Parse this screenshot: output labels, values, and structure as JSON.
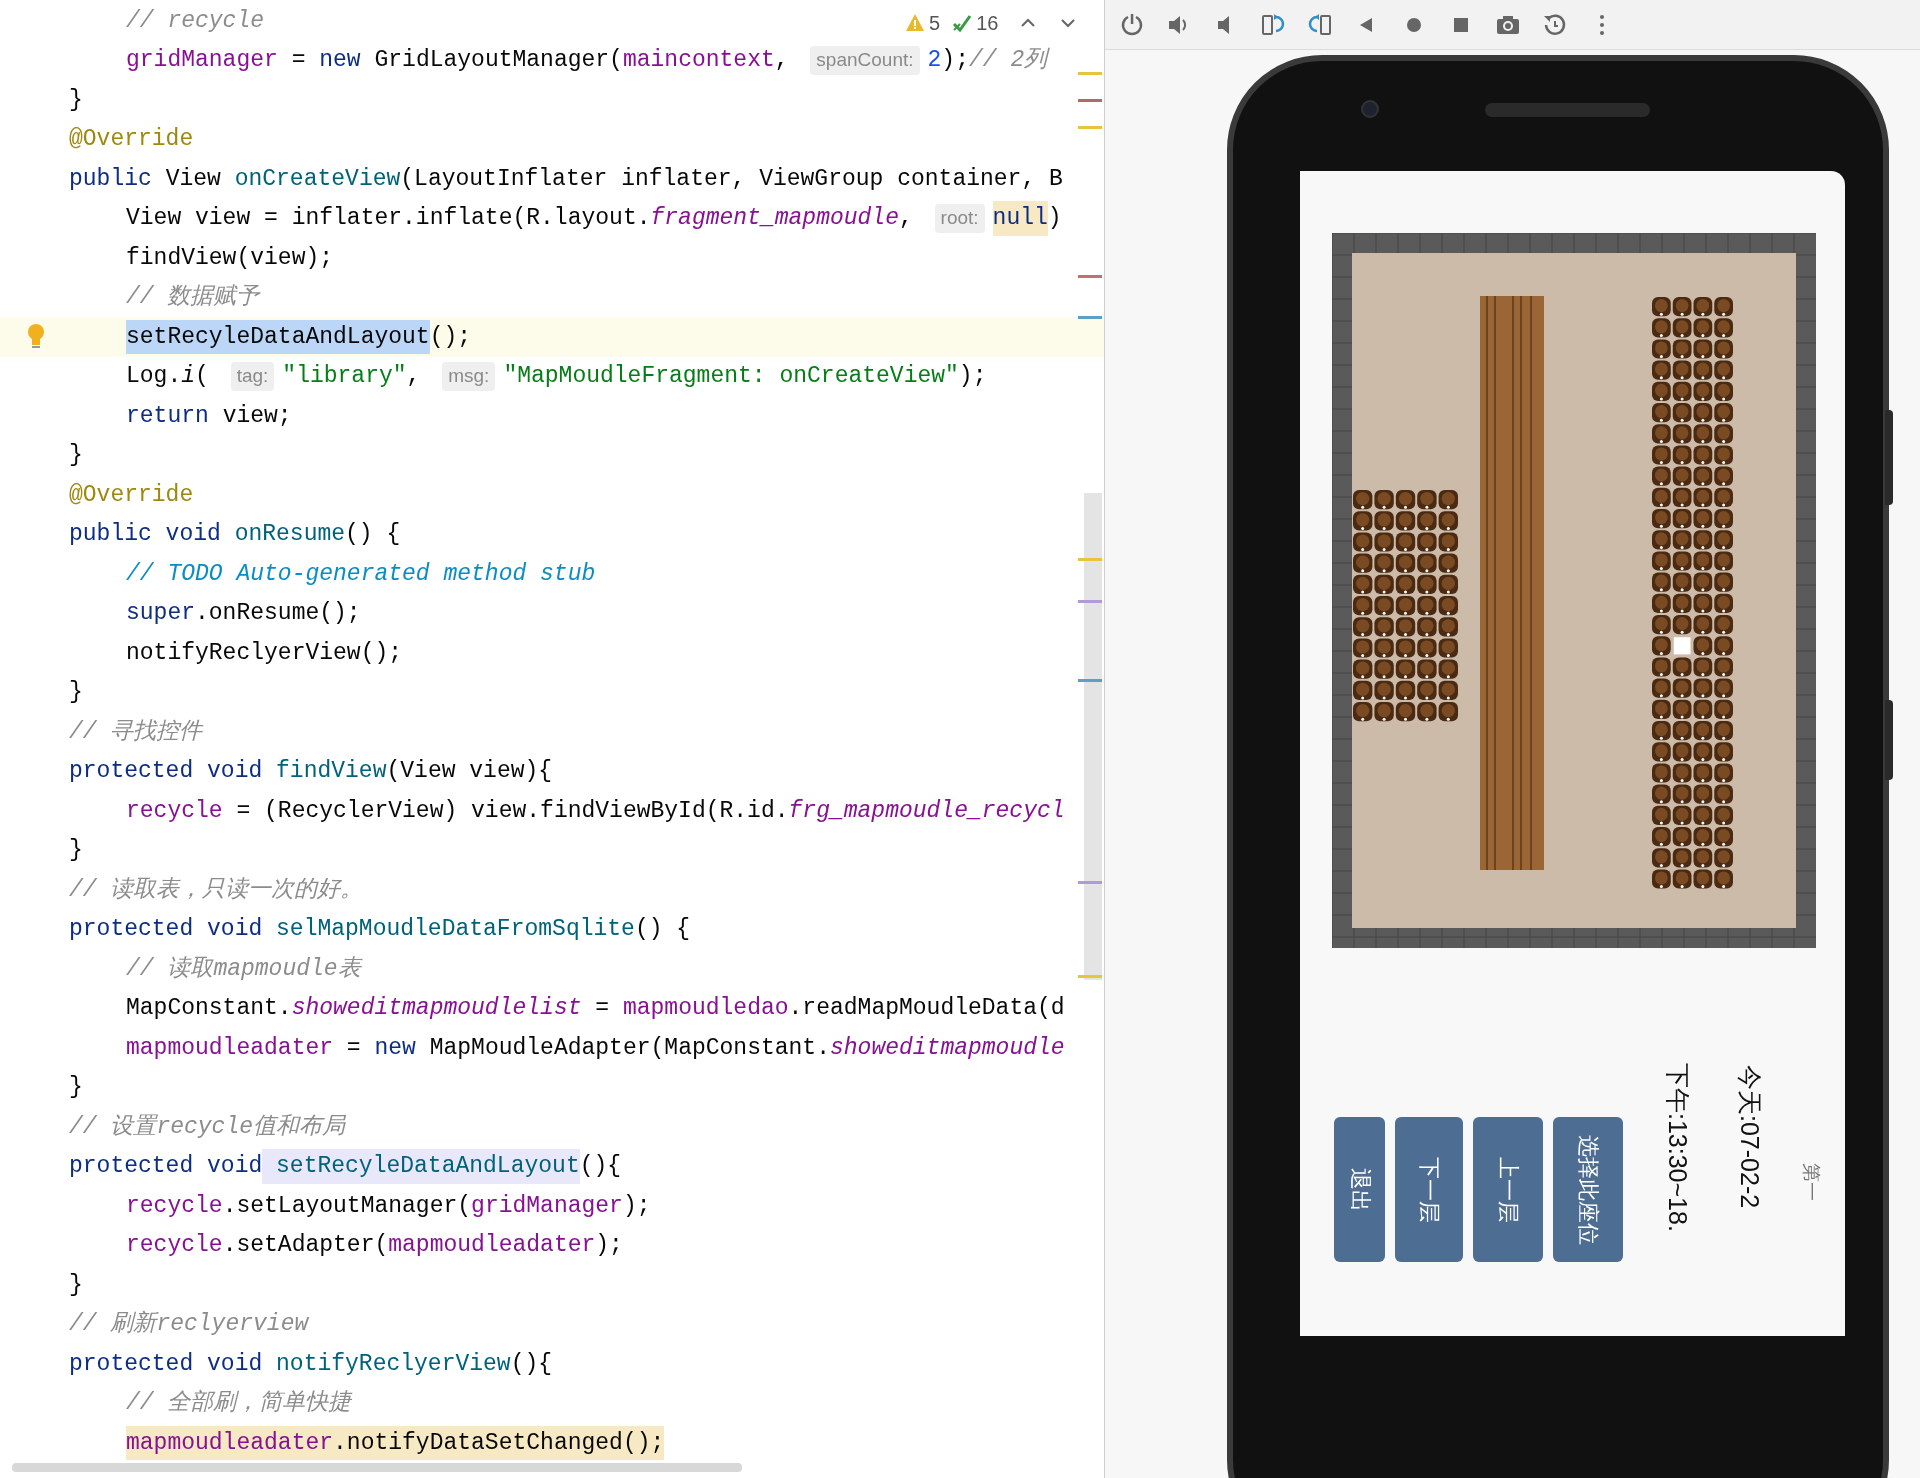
{
  "editor": {
    "inspections": [
      {
        "kind": "warning",
        "count": "5"
      },
      {
        "kind": "typo",
        "count": "16"
      }
    ],
    "lines": [
      {
        "indented": true,
        "current": false,
        "tokens": [
          {
            "kind": "comment",
            "text": "// recycle"
          }
        ]
      },
      {
        "indented": true,
        "current": false,
        "tokens": [
          {
            "kind": "field",
            "text": "gridManager"
          },
          {
            "kind": "plain",
            "text": " = "
          },
          {
            "kind": "kw",
            "text": "new"
          },
          {
            "kind": "plain",
            "text": " GridLayoutManager("
          },
          {
            "kind": "field",
            "text": "maincontext"
          },
          {
            "kind": "plain",
            "text": ", "
          },
          {
            "kind": "hint",
            "text": "spanCount:"
          },
          {
            "kind": "number",
            "text": "2"
          },
          {
            "kind": "plain",
            "text": ");"
          },
          {
            "kind": "comment",
            "text": "// 2列"
          }
        ]
      },
      {
        "indented": false,
        "current": false,
        "tokens": [
          {
            "kind": "plain",
            "text": "}"
          }
        ]
      },
      {
        "indented": false,
        "current": false,
        "tokens": [
          {
            "kind": "annotation",
            "text": "@Override"
          }
        ]
      },
      {
        "indented": false,
        "current": false,
        "tokens": [
          {
            "kind": "kw",
            "text": "public"
          },
          {
            "kind": "plain",
            "text": " View "
          },
          {
            "kind": "method",
            "text": "onCreateView"
          },
          {
            "kind": "plain",
            "text": "(LayoutInflater inflater, ViewGroup container, B"
          }
        ]
      },
      {
        "indented": true,
        "current": false,
        "tokens": [
          {
            "kind": "plain",
            "text": "View view = inflater.inflate(R.layout."
          },
          {
            "kind": "static",
            "text": "fragment_mapmoudle"
          },
          {
            "kind": "plain",
            "text": ", "
          },
          {
            "kind": "hint",
            "text": "root:"
          },
          {
            "kind": "kw_match",
            "text": "null"
          },
          {
            "kind": "plain",
            "text": ")"
          }
        ]
      },
      {
        "indented": true,
        "current": false,
        "tokens": [
          {
            "kind": "plain",
            "text": "findView(view);"
          }
        ]
      },
      {
        "indented": true,
        "current": false,
        "tokens": [
          {
            "kind": "comment",
            "text": "// 数据赋予"
          }
        ]
      },
      {
        "indented": true,
        "current": true,
        "tokens": [
          {
            "kind": "selection",
            "text": "setRecyleDataAndLayout"
          },
          {
            "kind": "plain",
            "text": "();"
          }
        ]
      },
      {
        "indented": true,
        "current": false,
        "tokens": [
          {
            "kind": "plain",
            "text": "Log."
          },
          {
            "kind": "static_call",
            "text": "i"
          },
          {
            "kind": "plain",
            "text": "( "
          },
          {
            "kind": "hint",
            "text": "tag:"
          },
          {
            "kind": "string",
            "text": "\"library\""
          },
          {
            "kind": "plain",
            "text": ", "
          },
          {
            "kind": "hint",
            "text": "msg:"
          },
          {
            "kind": "string",
            "text": "\"MapMoudleFragment: onCreateView\""
          },
          {
            "kind": "plain",
            "text": ");"
          }
        ]
      },
      {
        "indented": true,
        "current": false,
        "tokens": [
          {
            "kind": "kw",
            "text": "return"
          },
          {
            "kind": "plain",
            "text": " view;"
          }
        ]
      },
      {
        "indented": false,
        "current": false,
        "tokens": [
          {
            "kind": "plain",
            "text": "}"
          }
        ]
      },
      {
        "indented": false,
        "current": false,
        "tokens": [
          {
            "kind": "annotation",
            "text": "@Override"
          }
        ]
      },
      {
        "indented": false,
        "current": false,
        "tokens": [
          {
            "kind": "kw",
            "text": "public void"
          },
          {
            "kind": "method",
            "text": " onResume"
          },
          {
            "kind": "plain",
            "text": "() {"
          }
        ]
      },
      {
        "indented": true,
        "current": false,
        "tokens": [
          {
            "kind": "todo",
            "text": "// TODO Auto-generated method stub"
          }
        ]
      },
      {
        "indented": true,
        "current": false,
        "tokens": [
          {
            "kind": "kw",
            "text": "super"
          },
          {
            "kind": "plain",
            "text": ".onResume();"
          }
        ]
      },
      {
        "indented": true,
        "current": false,
        "tokens": [
          {
            "kind": "plain",
            "text": "notifyReclyerView();"
          }
        ]
      },
      {
        "indented": false,
        "current": false,
        "tokens": [
          {
            "kind": "plain",
            "text": "}"
          }
        ]
      },
      {
        "indented": false,
        "current": false,
        "tokens": [
          {
            "kind": "comment",
            "text": "// 寻找控件"
          }
        ]
      },
      {
        "indented": false,
        "current": false,
        "tokens": [
          {
            "kind": "kw",
            "text": "protected void"
          },
          {
            "kind": "method",
            "text": " findView"
          },
          {
            "kind": "plain",
            "text": "(View view){"
          }
        ]
      },
      {
        "indented": true,
        "current": false,
        "tokens": [
          {
            "kind": "field",
            "text": "recycle"
          },
          {
            "kind": "plain",
            "text": " = (RecyclerView) view.findViewById(R.id."
          },
          {
            "kind": "static",
            "text": "frg_mapmoudle_recycl"
          }
        ]
      },
      {
        "indented": false,
        "current": false,
        "tokens": [
          {
            "kind": "plain",
            "text": "}"
          }
        ]
      },
      {
        "indented": false,
        "current": false,
        "tokens": [
          {
            "kind": "comment",
            "text": "// 读取表，只读一次的好。"
          }
        ]
      },
      {
        "indented": false,
        "current": false,
        "tokens": [
          {
            "kind": "kw",
            "text": "protected void"
          },
          {
            "kind": "method",
            "text": " selMapMoudleDataFromSqlite"
          },
          {
            "kind": "plain",
            "text": "() {"
          }
        ]
      },
      {
        "indented": true,
        "current": false,
        "tokens": [
          {
            "kind": "comment",
            "text": "// 读取mapmoudle表"
          }
        ]
      },
      {
        "indented": true,
        "current": false,
        "tokens": [
          {
            "kind": "plain",
            "text": "MapConstant."
          },
          {
            "kind": "static",
            "text": "showeditmapmoudlelist"
          },
          {
            "kind": "plain",
            "text": " = "
          },
          {
            "kind": "field",
            "text": "mapmoudledao"
          },
          {
            "kind": "plain",
            "text": ".readMapMoudleData(d"
          }
        ]
      },
      {
        "indented": true,
        "current": false,
        "tokens": [
          {
            "kind": "field",
            "text": "mapmoudleadater"
          },
          {
            "kind": "plain",
            "text": " = "
          },
          {
            "kind": "kw",
            "text": "new"
          },
          {
            "kind": "plain",
            "text": " MapMoudleAdapter(MapConstant."
          },
          {
            "kind": "static",
            "text": "showeditmapmoudle"
          }
        ]
      },
      {
        "indented": false,
        "current": false,
        "tokens": [
          {
            "kind": "plain",
            "text": "}"
          }
        ]
      },
      {
        "indented": false,
        "current": false,
        "tokens": [
          {
            "kind": "comment",
            "text": "// 设置recycle值和布局"
          }
        ]
      },
      {
        "indented": false,
        "current": false,
        "tokens": [
          {
            "kind": "kw",
            "text": "protected void"
          },
          {
            "kind": "usage",
            "text": " setRecyleDataAndLayout"
          },
          {
            "kind": "plain",
            "text": "(){"
          }
        ]
      },
      {
        "indented": true,
        "current": false,
        "tokens": [
          {
            "kind": "field",
            "text": "recycle"
          },
          {
            "kind": "plain",
            "text": ".setLayoutManager("
          },
          {
            "kind": "field",
            "text": "gridManager"
          },
          {
            "kind": "plain",
            "text": ");"
          }
        ]
      },
      {
        "indented": true,
        "current": false,
        "tokens": [
          {
            "kind": "field",
            "text": "recycle"
          },
          {
            "kind": "plain",
            "text": ".setAdapter("
          },
          {
            "kind": "field",
            "text": "mapmoudleadater"
          },
          {
            "kind": "plain",
            "text": ");"
          }
        ]
      },
      {
        "indented": false,
        "current": false,
        "tokens": [
          {
            "kind": "plain",
            "text": "}"
          }
        ]
      },
      {
        "indented": false,
        "current": false,
        "tokens": [
          {
            "kind": "comment",
            "text": "// 刷新reclyerview"
          }
        ]
      },
      {
        "indented": false,
        "current": false,
        "tokens": [
          {
            "kind": "kw",
            "text": "protected void"
          },
          {
            "kind": "method",
            "text": " notifyReclyerView"
          },
          {
            "kind": "plain",
            "text": "(){"
          }
        ]
      },
      {
        "indented": true,
        "current": false,
        "tokens": [
          {
            "kind": "comment",
            "text": "// 全部刷，简单快捷"
          }
        ]
      },
      {
        "indented": true,
        "current": false,
        "tokens": [
          {
            "kind": "field_match",
            "text": "mapmoudleadater"
          },
          {
            "kind": "match",
            "text": ".notifyDataSetChanged();"
          }
        ]
      }
    ]
  },
  "emulator": {
    "toolbar": [
      {
        "kind": "power"
      },
      {
        "kind": "volume_up"
      },
      {
        "kind": "volume_down"
      },
      {
        "kind": "rotate_left"
      },
      {
        "kind": "rotate_right"
      },
      {
        "kind": "back"
      },
      {
        "kind": "home"
      },
      {
        "kind": "overview"
      },
      {
        "kind": "screenshot"
      },
      {
        "kind": "snapshot"
      },
      {
        "kind": "more"
      }
    ],
    "screen": {
      "buttons": [
        "退出",
        "下一层",
        "上一层",
        "选择此座位"
      ],
      "info": [
        {
          "kind": "time",
          "text": "下午:13:30~18."
        },
        {
          "kind": "date",
          "text": "今天:07-02-2"
        },
        {
          "kind": "floor",
          "text": "第一"
        }
      ]
    }
  }
}
